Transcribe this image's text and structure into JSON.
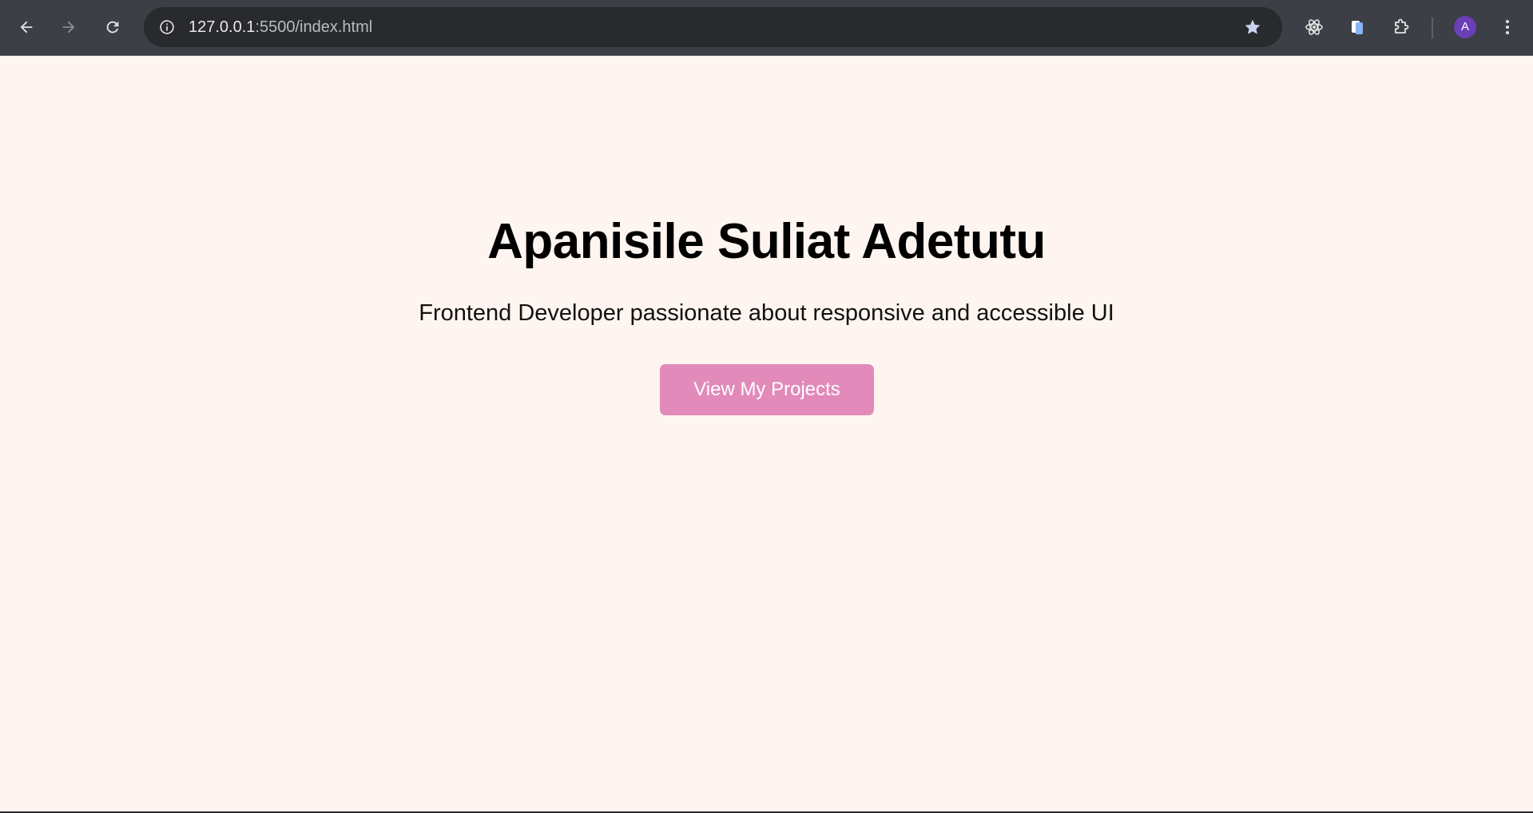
{
  "browser": {
    "url_host": "127.0.0.1",
    "url_rest": ":5500/index.html",
    "avatar_letter": "A",
    "icons": {
      "back": "arrow-left-icon",
      "forward": "arrow-right-icon",
      "reload": "reload-icon",
      "site_info": "info-icon",
      "bookmark": "star-icon",
      "react_devtools": "react-atom-icon",
      "extension_1": "document-extension-icon",
      "extensions": "puzzle-icon",
      "menu": "kebab-menu-icon"
    }
  },
  "page": {
    "title": "Apanisile Suliat Adetutu",
    "subtitle": "Frontend Developer passionate about responsive and accessible UI",
    "cta_label": "View My Projects"
  },
  "colors": {
    "page_background": "#fff5f0",
    "button_background": "#e28aba",
    "button_text": "#ffffff",
    "chrome_background": "#3c3f45",
    "omnibox_background": "#282a2e",
    "avatar_background": "#6a3fb8"
  }
}
